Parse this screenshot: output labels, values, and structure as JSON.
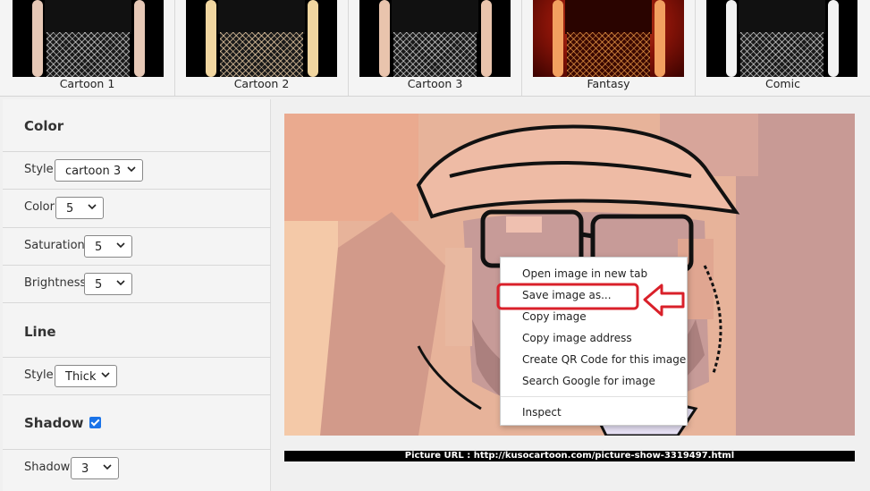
{
  "thumbnails": [
    {
      "label": "Cartoon 1"
    },
    {
      "label": "Cartoon 2"
    },
    {
      "label": "Cartoon 3"
    },
    {
      "label": "Fantasy"
    },
    {
      "label": "Comic"
    }
  ],
  "color_section": {
    "title": "Color",
    "style_label": "Style",
    "style_value": "cartoon 3",
    "color_label": "Color",
    "color_value": "5",
    "saturation_label": "Saturation",
    "saturation_value": "5",
    "brightness_label": "Brightness",
    "brightness_value": "5"
  },
  "line_section": {
    "title": "Line",
    "style_label": "Style",
    "style_value": "Thick"
  },
  "shadow_section": {
    "title": "Shadow",
    "checked": true,
    "shadow_label": "Shadow",
    "shadow_value": "3"
  },
  "picture_url": "Picture URL : http://kusocartoon.com/picture-show-3319497.html",
  "context_menu": {
    "items": [
      "Open image in new tab",
      "Save image as...",
      "Copy image",
      "Copy image address",
      "Create QR Code for this image",
      "Search Google for image",
      "Inspect"
    ],
    "highlighted_index": 1
  },
  "colors": {
    "annotation_red": "#d9202a",
    "checkbox_blue": "#1a73e8"
  }
}
